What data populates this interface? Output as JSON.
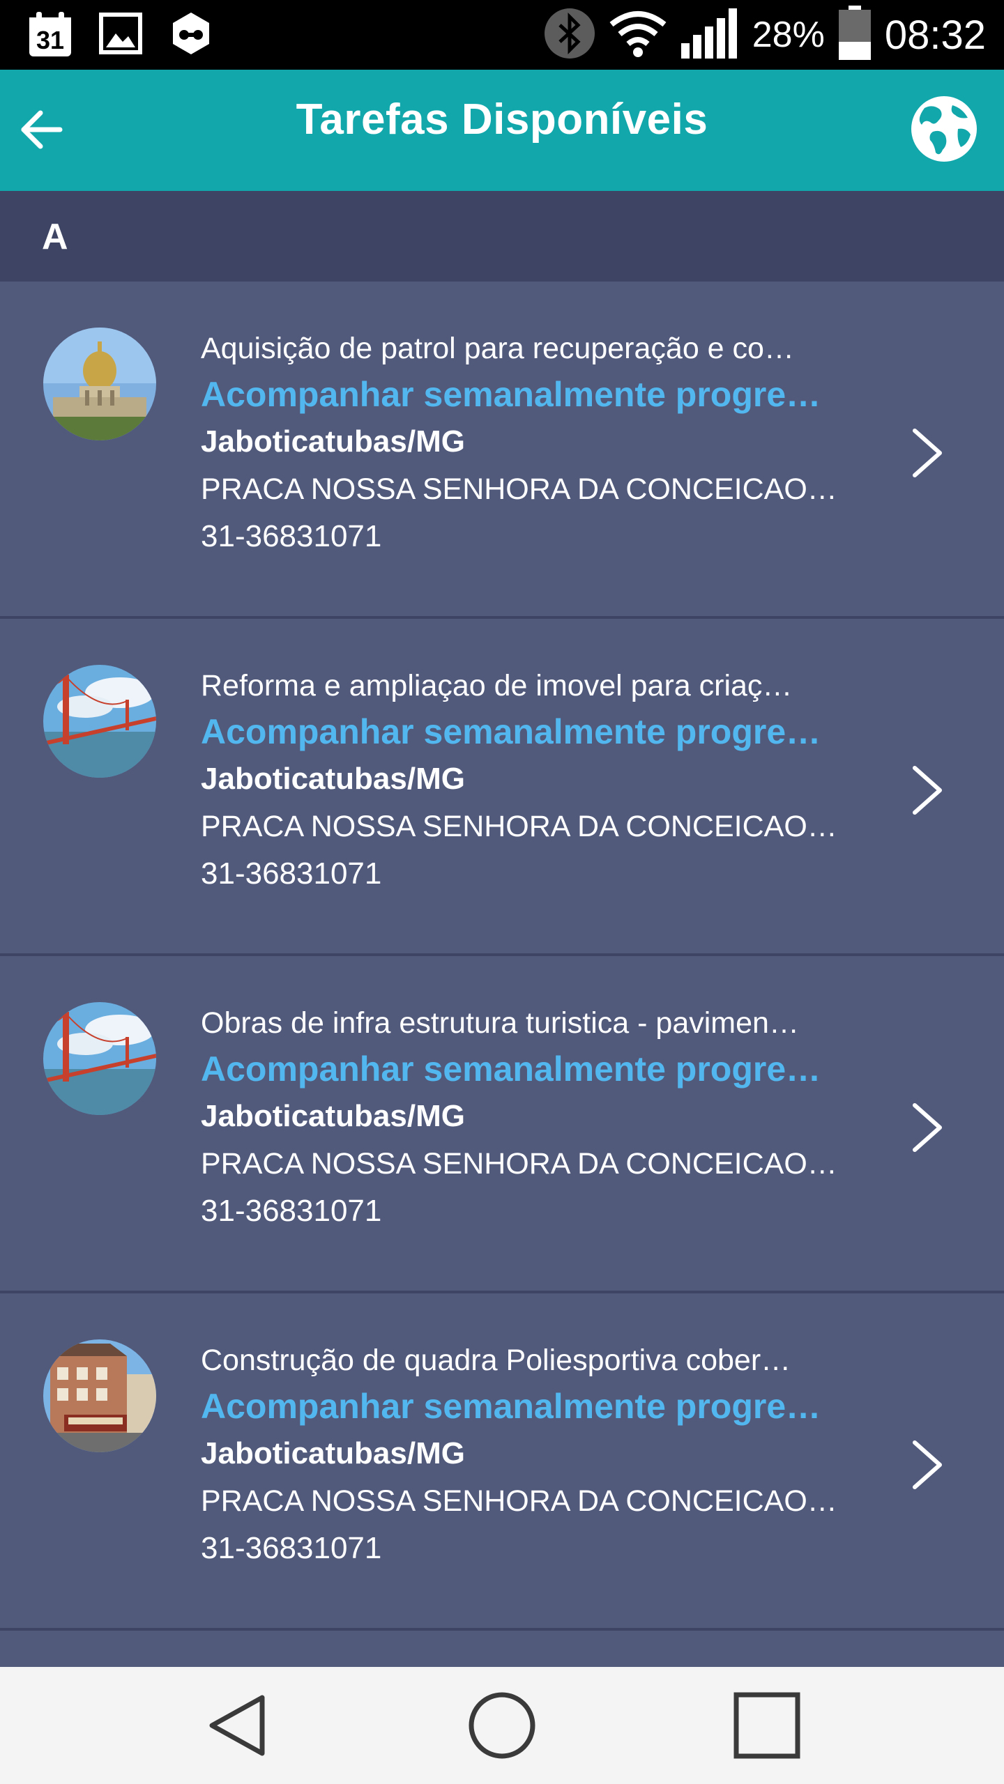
{
  "status_bar": {
    "calendar_day": "31",
    "battery_percent": "28%",
    "time": "08:32"
  },
  "app_bar": {
    "title": "Tarefas Disponíveis"
  },
  "section": {
    "letter": "A"
  },
  "tasks": [
    {
      "title": "Aquisição de patrol para recuperação e co…",
      "action": "Acompanhar semanalmente progre…",
      "city": "Jaboticatubas/MG",
      "address": "PRACA NOSSA SENHORA DA CONCEICAO…",
      "phone": "31-36831071",
      "image": "dome-building"
    },
    {
      "title": "Reforma e ampliaçao de imovel para criaç…",
      "action": "Acompanhar semanalmente progre…",
      "city": "Jaboticatubas/MG",
      "address": "PRACA NOSSA SENHORA DA CONCEICAO…",
      "phone": "31-36831071",
      "image": "golden-gate-bridge"
    },
    {
      "title": "Obras de infra estrutura turistica - pavimen…",
      "action": "Acompanhar semanalmente progre…",
      "city": "Jaboticatubas/MG",
      "address": "PRACA NOSSA SENHORA DA CONCEICAO…",
      "phone": "31-36831071",
      "image": "golden-gate-bridge"
    },
    {
      "title": "Construção de quadra Poliesportiva cober…",
      "action": "Acompanhar semanalmente progre…",
      "city": "Jaboticatubas/MG",
      "address": "PRACA NOSSA SENHORA DA CONCEICAO…",
      "phone": "31-36831071",
      "image": "street-building"
    }
  ],
  "colors": {
    "app_bar": "#11a7ab",
    "list_bg": "#525a7c",
    "section_bg": "#3e4564",
    "action_text": "#52b7ee"
  }
}
